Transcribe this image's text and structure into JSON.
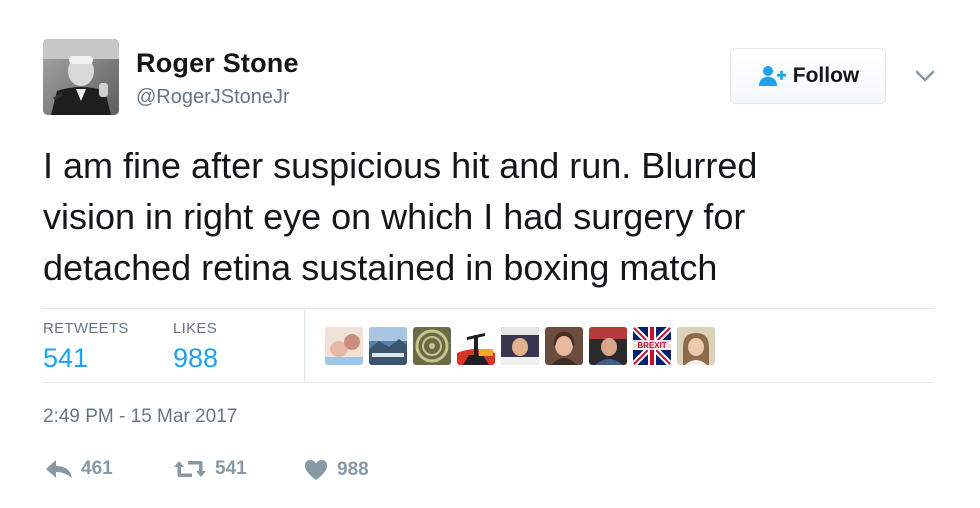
{
  "user": {
    "name": "Roger Stone",
    "handle": "@RogerJStoneJr"
  },
  "follow_button": {
    "label": "Follow",
    "icon": "follow-person-plus-icon"
  },
  "tweet": {
    "text": "I am fine after suspicious hit and run. Blurred\nvision in right eye on which I had surgery for\ndetached retina sustained in boxing match"
  },
  "stats": {
    "retweets_label": "RETWEETS",
    "retweets_value": "541",
    "likes_label": "LIKES",
    "likes_value": "988"
  },
  "likers": [
    {
      "name": "liker-avatar-1"
    },
    {
      "name": "liker-avatar-2"
    },
    {
      "name": "liker-avatar-3"
    },
    {
      "name": "liker-avatar-4"
    },
    {
      "name": "liker-avatar-5"
    },
    {
      "name": "liker-avatar-6"
    },
    {
      "name": "liker-avatar-7"
    },
    {
      "name": "liker-avatar-8",
      "text": "BREXIT"
    },
    {
      "name": "liker-avatar-9"
    }
  ],
  "timestamp": "2:49 PM - 15 Mar 2017",
  "actions": {
    "reply_count": "461",
    "retweet_count": "541",
    "like_count": "988"
  },
  "colors": {
    "accent": "#1da1f2",
    "text": "#14171a",
    "muted": "#657786",
    "action_gray": "#8899a6",
    "border": "#e1e8ed"
  }
}
